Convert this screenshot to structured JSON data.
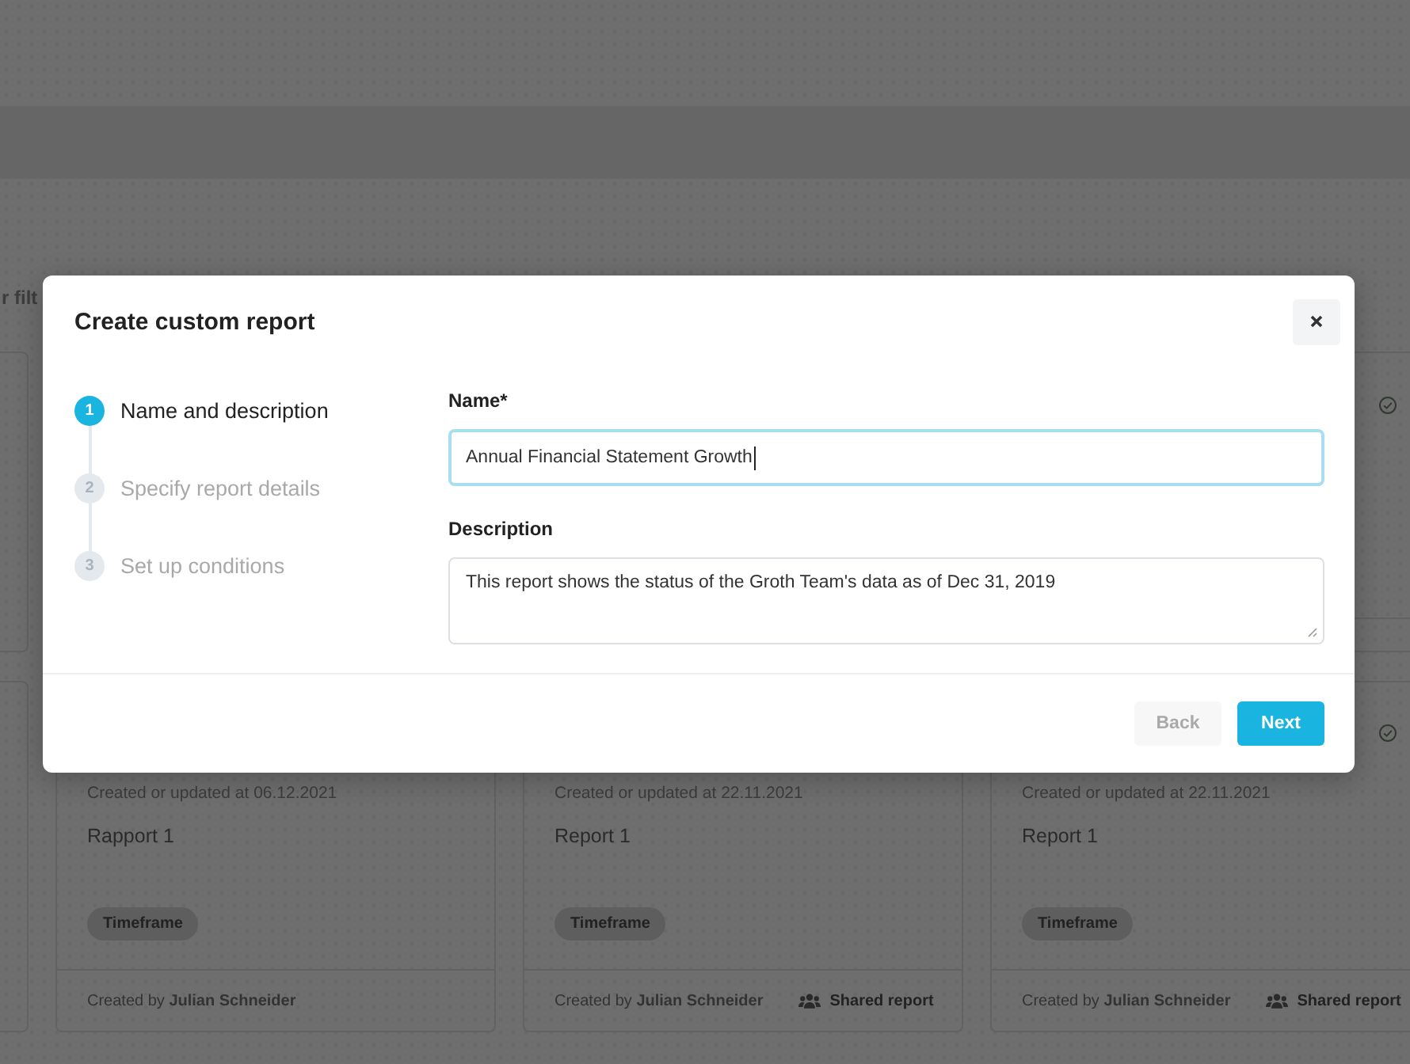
{
  "background": {
    "filter_text": "r filt",
    "cards": [
      {
        "updated": "Created or updated at 06.12.2021",
        "name": "Rapport 1",
        "tag": "Timeframe",
        "creator": "Created by **Julian Schneider**"
      },
      {
        "updated": "Created or updated at 22.11.2021",
        "name": "Report 1",
        "tag": "Timeframe",
        "creator": "Created by **Julian Schneider**",
        "shared": "Shared report"
      },
      {
        "updated": "Created or updated at 22.11.2021",
        "name": "Report 1",
        "tag": "Timeframe",
        "creator": "Created by **Julian Schneider**",
        "shared": "Shared report"
      }
    ]
  },
  "dialog": {
    "title": "Create custom report",
    "steps": [
      {
        "number": "1",
        "label": "Name and description",
        "selected": true
      },
      {
        "number": "2",
        "label": "Specify report details",
        "selected": false
      },
      {
        "number": "3",
        "label": "Set up conditions",
        "selected": false
      }
    ],
    "fields": [
      {
        "kind": "input",
        "label": "Name*",
        "value": "Annual Financial Statement Growth",
        "focused": true
      },
      {
        "kind": "textarea",
        "label": "Description",
        "value": "This report shows the status of the Groth Team's data as of Dec 31, 2019",
        "focused": false
      }
    ],
    "buttons": [
      {
        "label": "Back",
        "disabled": true,
        "primary": false
      },
      {
        "label": "Next",
        "disabled": false,
        "primary": true
      }
    ]
  }
}
